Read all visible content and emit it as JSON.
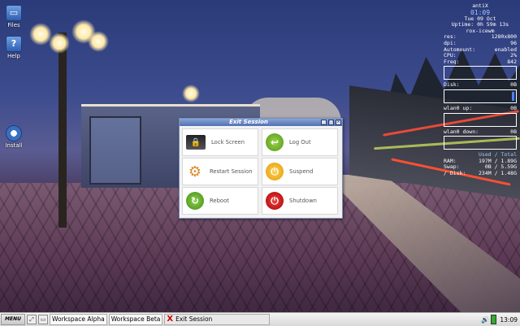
{
  "desktop_icons": [
    {
      "label": "Files",
      "icon": "folder-icon"
    },
    {
      "label": "Help",
      "icon": "help-icon"
    },
    {
      "label": "Install",
      "icon": "install-icon"
    }
  ],
  "conky": {
    "distro": "antiX",
    "time": "01:09",
    "date": "Tue 09 Oct",
    "uptime": "Uptime: 0h 59m 13s",
    "wm": "rox-icewm",
    "stats": [
      {
        "label": "res:",
        "value": "1280x800"
      },
      {
        "label": "dpi:",
        "value": "96"
      },
      {
        "label": "Automount:",
        "value": "enabled"
      },
      {
        "label": "CPU:",
        "value": "2%"
      },
      {
        "label": "Freq:",
        "value": "842"
      }
    ],
    "disk_label": "Disk:",
    "disk_value": "0B",
    "wlan_up_label": "wlan0 up:",
    "wlan_up_value": "0B",
    "wlan_down_label": "wlan0 down:",
    "wlan_down_value": "0B",
    "usage_header": "Used / Total",
    "usage": [
      {
        "label": "RAM:",
        "used": "197M",
        "total": "/ 1.89G"
      },
      {
        "label": "Swap:",
        "used": "0B",
        "total": "/ 5.59G"
      },
      {
        "label": "/ Disk:",
        "used": "234M",
        "total": "/ 1.48G"
      }
    ]
  },
  "dialog": {
    "title": "Exit Session",
    "options": [
      {
        "label": "Lock Screen",
        "icon": "lock-screen-icon"
      },
      {
        "label": "Log Out",
        "icon": "log-out-icon"
      },
      {
        "label": "Restart Session",
        "icon": "restart-session-icon"
      },
      {
        "label": "Suspend",
        "icon": "suspend-icon"
      },
      {
        "label": "Reboot",
        "icon": "reboot-icon"
      },
      {
        "label": "Shutdown",
        "icon": "shutdown-icon"
      }
    ]
  },
  "taskbar": {
    "menu_label": "MENU",
    "tasks": [
      "Workspace Alpha",
      "Workspace Beta"
    ],
    "active_task": "Exit Session",
    "clock": "13:09"
  }
}
